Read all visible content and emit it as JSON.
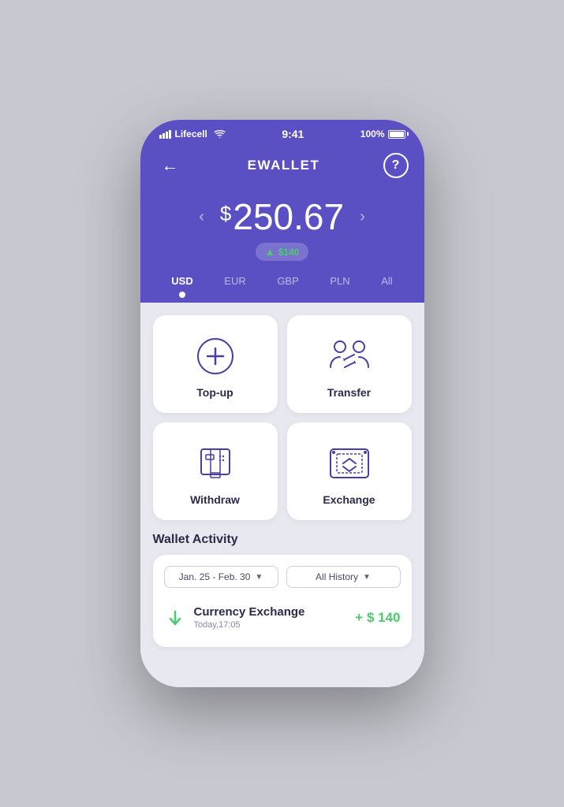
{
  "statusBar": {
    "carrier": "Lifecell",
    "time": "9:41",
    "battery": "100%"
  },
  "header": {
    "title": "EWALLET",
    "backLabel": "←",
    "helpLabel": "?"
  },
  "balance": {
    "currencySymbol": "$",
    "amount": "250.67",
    "badgeArrow": "▲",
    "badgeAmount": "$140"
  },
  "currencyTabs": [
    {
      "code": "USD",
      "active": true
    },
    {
      "code": "EUR",
      "active": false
    },
    {
      "code": "GBP",
      "active": false
    },
    {
      "code": "PLN",
      "active": false
    },
    {
      "code": "All",
      "active": false
    }
  ],
  "actions": [
    {
      "id": "topup",
      "label": "Top-up",
      "icon": "topup-icon"
    },
    {
      "id": "transfer",
      "label": "Transfer",
      "icon": "transfer-icon"
    },
    {
      "id": "withdraw",
      "label": "Withdraw",
      "icon": "withdraw-icon"
    },
    {
      "id": "exchange",
      "label": "Exchange",
      "icon": "exchange-icon"
    }
  ],
  "walletActivity": {
    "title": "Wallet Activity",
    "dateFilter": "Jan. 25 - Feb. 30",
    "historyFilter": "All History",
    "transactions": [
      {
        "name": "Currency Exchange",
        "time": "Today,17:05",
        "amount": "+ $ 140",
        "direction": "down"
      }
    ]
  }
}
